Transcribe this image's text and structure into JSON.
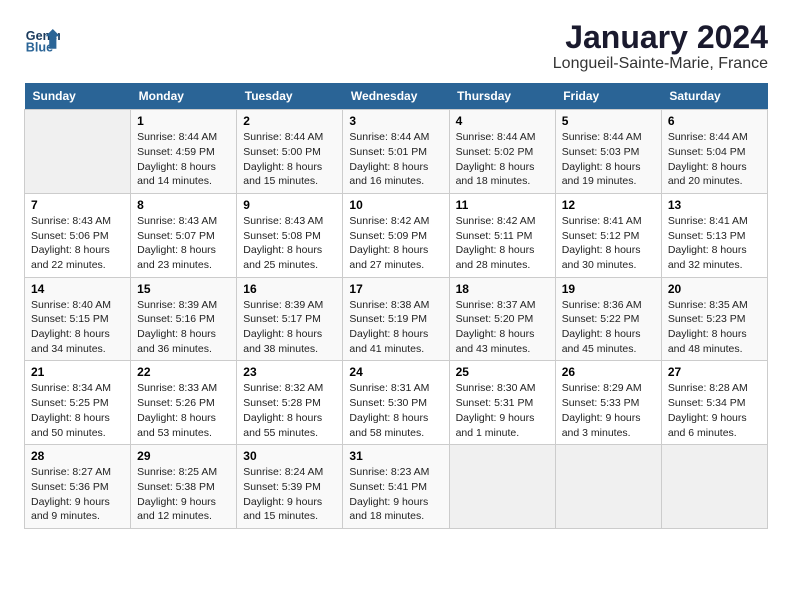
{
  "logo": {
    "text_general": "General",
    "text_blue": "Blue"
  },
  "title": "January 2024",
  "subtitle": "Longueil-Sainte-Marie, France",
  "days_of_week": [
    "Sunday",
    "Monday",
    "Tuesday",
    "Wednesday",
    "Thursday",
    "Friday",
    "Saturday"
  ],
  "weeks": [
    [
      {
        "day": "",
        "empty": true
      },
      {
        "day": "1",
        "sunrise": "Sunrise: 8:44 AM",
        "sunset": "Sunset: 4:59 PM",
        "daylight": "Daylight: 8 hours and 14 minutes."
      },
      {
        "day": "2",
        "sunrise": "Sunrise: 8:44 AM",
        "sunset": "Sunset: 5:00 PM",
        "daylight": "Daylight: 8 hours and 15 minutes."
      },
      {
        "day": "3",
        "sunrise": "Sunrise: 8:44 AM",
        "sunset": "Sunset: 5:01 PM",
        "daylight": "Daylight: 8 hours and 16 minutes."
      },
      {
        "day": "4",
        "sunrise": "Sunrise: 8:44 AM",
        "sunset": "Sunset: 5:02 PM",
        "daylight": "Daylight: 8 hours and 18 minutes."
      },
      {
        "day": "5",
        "sunrise": "Sunrise: 8:44 AM",
        "sunset": "Sunset: 5:03 PM",
        "daylight": "Daylight: 8 hours and 19 minutes."
      },
      {
        "day": "6",
        "sunrise": "Sunrise: 8:44 AM",
        "sunset": "Sunset: 5:04 PM",
        "daylight": "Daylight: 8 hours and 20 minutes."
      }
    ],
    [
      {
        "day": "7",
        "sunrise": "Sunrise: 8:43 AM",
        "sunset": "Sunset: 5:06 PM",
        "daylight": "Daylight: 8 hours and 22 minutes."
      },
      {
        "day": "8",
        "sunrise": "Sunrise: 8:43 AM",
        "sunset": "Sunset: 5:07 PM",
        "daylight": "Daylight: 8 hours and 23 minutes."
      },
      {
        "day": "9",
        "sunrise": "Sunrise: 8:43 AM",
        "sunset": "Sunset: 5:08 PM",
        "daylight": "Daylight: 8 hours and 25 minutes."
      },
      {
        "day": "10",
        "sunrise": "Sunrise: 8:42 AM",
        "sunset": "Sunset: 5:09 PM",
        "daylight": "Daylight: 8 hours and 27 minutes."
      },
      {
        "day": "11",
        "sunrise": "Sunrise: 8:42 AM",
        "sunset": "Sunset: 5:11 PM",
        "daylight": "Daylight: 8 hours and 28 minutes."
      },
      {
        "day": "12",
        "sunrise": "Sunrise: 8:41 AM",
        "sunset": "Sunset: 5:12 PM",
        "daylight": "Daylight: 8 hours and 30 minutes."
      },
      {
        "day": "13",
        "sunrise": "Sunrise: 8:41 AM",
        "sunset": "Sunset: 5:13 PM",
        "daylight": "Daylight: 8 hours and 32 minutes."
      }
    ],
    [
      {
        "day": "14",
        "sunrise": "Sunrise: 8:40 AM",
        "sunset": "Sunset: 5:15 PM",
        "daylight": "Daylight: 8 hours and 34 minutes."
      },
      {
        "day": "15",
        "sunrise": "Sunrise: 8:39 AM",
        "sunset": "Sunset: 5:16 PM",
        "daylight": "Daylight: 8 hours and 36 minutes."
      },
      {
        "day": "16",
        "sunrise": "Sunrise: 8:39 AM",
        "sunset": "Sunset: 5:17 PM",
        "daylight": "Daylight: 8 hours and 38 minutes."
      },
      {
        "day": "17",
        "sunrise": "Sunrise: 8:38 AM",
        "sunset": "Sunset: 5:19 PM",
        "daylight": "Daylight: 8 hours and 41 minutes."
      },
      {
        "day": "18",
        "sunrise": "Sunrise: 8:37 AM",
        "sunset": "Sunset: 5:20 PM",
        "daylight": "Daylight: 8 hours and 43 minutes."
      },
      {
        "day": "19",
        "sunrise": "Sunrise: 8:36 AM",
        "sunset": "Sunset: 5:22 PM",
        "daylight": "Daylight: 8 hours and 45 minutes."
      },
      {
        "day": "20",
        "sunrise": "Sunrise: 8:35 AM",
        "sunset": "Sunset: 5:23 PM",
        "daylight": "Daylight: 8 hours and 48 minutes."
      }
    ],
    [
      {
        "day": "21",
        "sunrise": "Sunrise: 8:34 AM",
        "sunset": "Sunset: 5:25 PM",
        "daylight": "Daylight: 8 hours and 50 minutes."
      },
      {
        "day": "22",
        "sunrise": "Sunrise: 8:33 AM",
        "sunset": "Sunset: 5:26 PM",
        "daylight": "Daylight: 8 hours and 53 minutes."
      },
      {
        "day": "23",
        "sunrise": "Sunrise: 8:32 AM",
        "sunset": "Sunset: 5:28 PM",
        "daylight": "Daylight: 8 hours and 55 minutes."
      },
      {
        "day": "24",
        "sunrise": "Sunrise: 8:31 AM",
        "sunset": "Sunset: 5:30 PM",
        "daylight": "Daylight: 8 hours and 58 minutes."
      },
      {
        "day": "25",
        "sunrise": "Sunrise: 8:30 AM",
        "sunset": "Sunset: 5:31 PM",
        "daylight": "Daylight: 9 hours and 1 minute."
      },
      {
        "day": "26",
        "sunrise": "Sunrise: 8:29 AM",
        "sunset": "Sunset: 5:33 PM",
        "daylight": "Daylight: 9 hours and 3 minutes."
      },
      {
        "day": "27",
        "sunrise": "Sunrise: 8:28 AM",
        "sunset": "Sunset: 5:34 PM",
        "daylight": "Daylight: 9 hours and 6 minutes."
      }
    ],
    [
      {
        "day": "28",
        "sunrise": "Sunrise: 8:27 AM",
        "sunset": "Sunset: 5:36 PM",
        "daylight": "Daylight: 9 hours and 9 minutes."
      },
      {
        "day": "29",
        "sunrise": "Sunrise: 8:25 AM",
        "sunset": "Sunset: 5:38 PM",
        "daylight": "Daylight: 9 hours and 12 minutes."
      },
      {
        "day": "30",
        "sunrise": "Sunrise: 8:24 AM",
        "sunset": "Sunset: 5:39 PM",
        "daylight": "Daylight: 9 hours and 15 minutes."
      },
      {
        "day": "31",
        "sunrise": "Sunrise: 8:23 AM",
        "sunset": "Sunset: 5:41 PM",
        "daylight": "Daylight: 9 hours and 18 minutes."
      },
      {
        "day": "",
        "empty": true
      },
      {
        "day": "",
        "empty": true
      },
      {
        "day": "",
        "empty": true
      }
    ]
  ]
}
